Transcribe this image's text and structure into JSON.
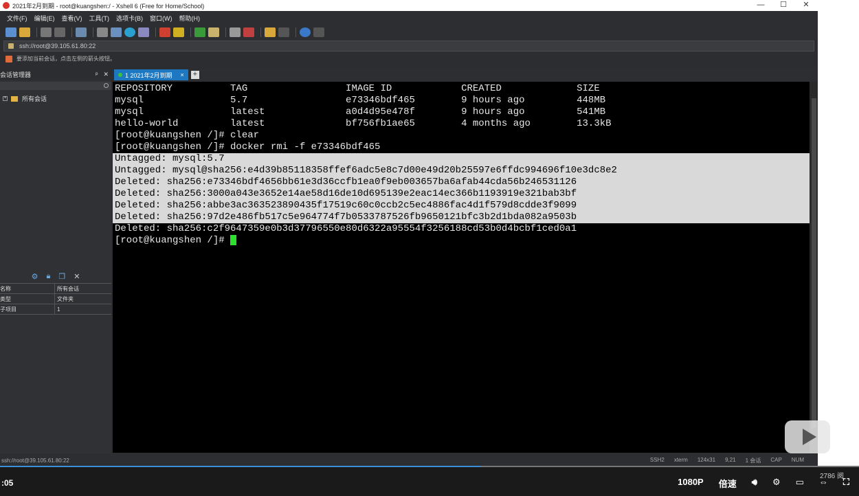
{
  "window": {
    "title": "2021年2月到期 - root@kuangshen:/ - Xshell 6 (Free for Home/School)",
    "min": "—",
    "max": "☐",
    "close": "✕"
  },
  "menu": [
    "文件(F)",
    "编辑(E)",
    "查看(V)",
    "工具(T)",
    "选项卡(B)",
    "窗口(W)",
    "帮助(H)"
  ],
  "address": "ssh://root@39.105.61.80:22",
  "hint": "要添加当前会话，点击左侧的箭头按钮。",
  "sidebar": {
    "title": "会话管理器",
    "pin": "ᵖ",
    "close": "✕",
    "tree_item": "所有会话",
    "props": [
      {
        "k": "名称",
        "v": "所有会话"
      },
      {
        "k": "类型",
        "v": "文件夹"
      },
      {
        "k": "子项目",
        "v": "1"
      }
    ]
  },
  "tab": {
    "label": "1 2021年2月到期",
    "close": "×",
    "add": "+"
  },
  "terminal": {
    "lines": [
      {
        "text": "REPOSITORY          TAG                 IMAGE ID            CREATED             SIZE"
      },
      {
        "text": "mysql               5.7                 e73346bdf465        9 hours ago         448MB"
      },
      {
        "text": "mysql               latest              a0d4d95e478f        9 hours ago         541MB"
      },
      {
        "text": "hello-world         latest              bf756fb1ae65        4 months ago        13.3kB"
      },
      {
        "text": "[root@kuangshen /]# clear"
      },
      {
        "text": "[root@kuangshen /]# docker rmi -f e73346bdf465"
      },
      {
        "text": "Untagged: mysql:5.7",
        "hl": true
      },
      {
        "text": "Untagged: mysql@sha256:e4d39b85118358ffef6adc5e8c7d00e49d20b25597e6ffdc994696f10e3dc8e2",
        "hl": true
      },
      {
        "text": "Deleted: sha256:e73346bdf4656bb61e3d36ccfb1ea0f9eb003657ba6afab44cda56b246531126",
        "hl": true
      },
      {
        "text": "Deleted: sha256:3000a043e3652e14ae58d16de10d695139e2eac14ec366b1193919e321bab3bf",
        "hl": true
      },
      {
        "text": "Deleted: sha256:abbe3ac363523890435f17519c60c0ccb2c5ec4886fac4d1f579d8cdde3f9099",
        "hl": true
      },
      {
        "text": "Deleted: sha256:97d2e486fb517c5e964774f7b0533787526fb9650121bfc3b2d1bda082a9503b",
        "hl": true
      },
      {
        "text": "Deleted: sha256:c2f9647359e0b3d37796550e80d6322a95554f3256188cd53b0d4bcbf1ced0a1"
      },
      {
        "text": "[root@kuangshen /]# ",
        "prompt": true
      }
    ]
  },
  "status": {
    "left": "ssh://root@39.105.61.80:22",
    "items": [
      "SSH2",
      "xterm",
      "124x31",
      "9,21",
      "1 会话",
      "CAP",
      "NUM"
    ]
  },
  "video": {
    "time": ":05",
    "quality": "1080P",
    "speed": "倍速",
    "views": "2786 阅"
  }
}
